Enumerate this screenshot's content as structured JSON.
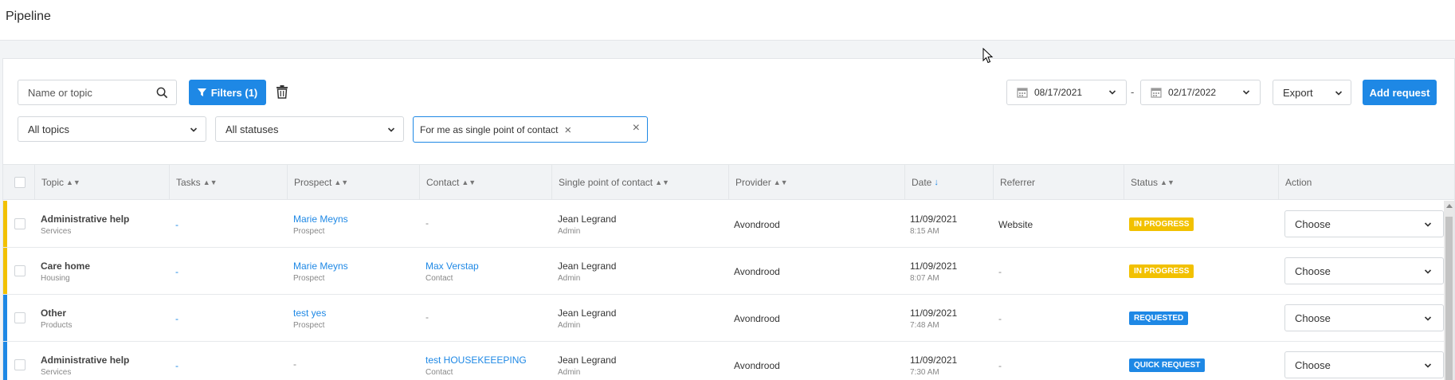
{
  "page": {
    "title": "Pipeline"
  },
  "toolbar": {
    "search_placeholder": "Name or topic",
    "filters_label": "Filters (1)",
    "date_from": "08/17/2021",
    "date_separator": "-",
    "date_to": "02/17/2022",
    "export_label": "Export",
    "add_request_label": "Add request",
    "topics_value": "All topics",
    "statuses_value": "All statuses",
    "chip_label": "For me as single point of contact",
    "chip_remove": "×",
    "chip_clear": "×"
  },
  "colors": {
    "primary": "#1e88e5",
    "in_progress": "#f2c100",
    "requested": "#1e88e5"
  },
  "table": {
    "headers": {
      "topic": "Topic",
      "tasks": "Tasks",
      "prospect": "Prospect",
      "contact": "Contact",
      "spoc": "Single point of contact",
      "provider": "Provider",
      "date": "Date",
      "referrer": "Referrer",
      "status": "Status",
      "action": "Action"
    },
    "rows": [
      {
        "accent": "#f2c100",
        "topic": "Administrative help",
        "topic_sub": "Services",
        "tasks": "-",
        "prospect": "Marie Meyns",
        "prospect_sub": "Prospect",
        "contact": "-",
        "contact_sub": "",
        "spoc": "Jean Legrand",
        "spoc_sub": "Admin",
        "provider": "Avondrood",
        "date": "11/09/2021",
        "time": "8:15 AM",
        "referrer": "Website",
        "status": "IN PROGRESS",
        "status_kind": "progress",
        "action": "Choose"
      },
      {
        "accent": "#f2c100",
        "topic": "Care home",
        "topic_sub": "Housing",
        "tasks": "-",
        "prospect": "Marie Meyns",
        "prospect_sub": "Prospect",
        "contact": "Max Verstap",
        "contact_sub": "Contact",
        "spoc": "Jean Legrand",
        "spoc_sub": "Admin",
        "provider": "Avondrood",
        "date": "11/09/2021",
        "time": "8:07 AM",
        "referrer": "-",
        "status": "IN PROGRESS",
        "status_kind": "progress",
        "action": "Choose"
      },
      {
        "accent": "#1e88e5",
        "topic": "Other",
        "topic_sub": "Products",
        "tasks": "-",
        "prospect": "test yes",
        "prospect_sub": "Prospect",
        "contact": "-",
        "contact_sub": "",
        "spoc": "Jean Legrand",
        "spoc_sub": "Admin",
        "provider": "Avondrood",
        "date": "11/09/2021",
        "time": "7:48 AM",
        "referrer": "-",
        "status": "REQUESTED",
        "status_kind": "requested",
        "action": "Choose"
      },
      {
        "accent": "#1e88e5",
        "topic": "Administrative help",
        "topic_sub": "Services",
        "tasks": "-",
        "prospect": "-",
        "prospect_sub": "",
        "contact": "test HOUSEKEEEPING",
        "contact_sub": "Contact",
        "spoc": "Jean Legrand",
        "spoc_sub": "Admin",
        "provider": "Avondrood",
        "date": "11/09/2021",
        "time": "7:30 AM",
        "referrer": "-",
        "status": "QUICK REQUEST",
        "status_kind": "quick",
        "action": "Choose"
      }
    ]
  }
}
